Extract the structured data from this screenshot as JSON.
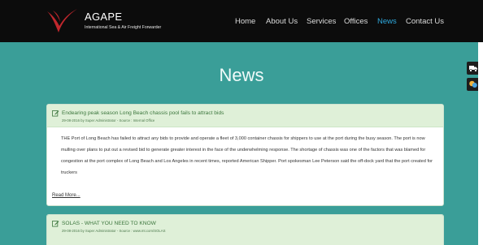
{
  "brand": {
    "name": "AGAPE",
    "tagline": "International Sea & Air Freight Forwarder",
    "accent_color": "#c0272d"
  },
  "nav": {
    "items": [
      "Home",
      "About Us",
      "Services",
      "Offices",
      "News",
      "Contact Us"
    ],
    "active": "News",
    "active_color": "#2ea8dc"
  },
  "side_widgets": [
    "truck-icon",
    "chat-bubbles-icon"
  ],
  "page": {
    "heading": "News",
    "background_color": "#3a9e98"
  },
  "news": [
    {
      "title": "Endearing peak season Long Beach chassis pool fails to attract bids",
      "meta": "29-08-2016 by Super Administrator - Source : Internal Office",
      "body": "THE Port of Long Beach has failed to attract any bids to provide and operate a fleet of 3,000 container chassis for shippers to use at the port during the busy season. The port is now mulling over plans to put out a revised bid to generate greater interest in the face of the underwhelming response. The shortage of chassis was one of the factors that was blamed for congestion at the port complex of Long Beach and Los Angeles in recent times, reported American Shipper. Port spokesman Lee Peterson said the off-dock yard that the port created for truckers",
      "read_more": "Read More..."
    },
    {
      "title": "SOLAS - WHAT YOU NEED TO KNOW",
      "meta": "29-08-2016 by Super Administrator - Source : www.mt.com/SOLAS"
    }
  ]
}
